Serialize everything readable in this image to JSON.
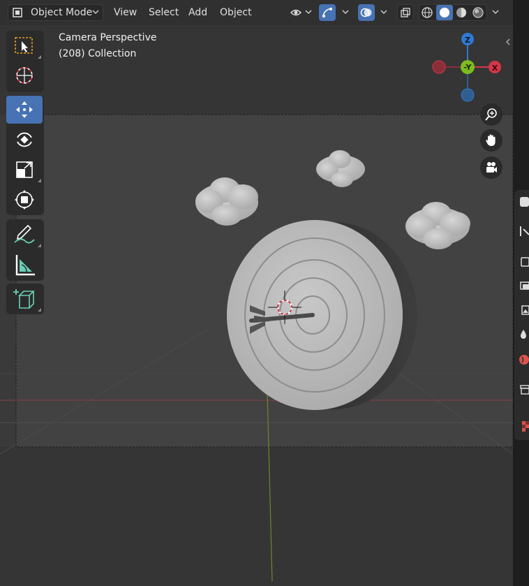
{
  "header": {
    "mode_label": "Object Mode",
    "menu": [
      "View",
      "Select",
      "Add",
      "Object"
    ]
  },
  "viewport": {
    "perspective_label": "Camera Perspective",
    "collection_label": "(208) Collection"
  },
  "gizmo": {
    "z_label": "Z",
    "y_label": "-Y",
    "x_label": "X"
  },
  "colors": {
    "active_tool": "#4772b3",
    "axis_x": "#d63648",
    "axis_y": "#7cbb1f",
    "axis_z": "#2f79cf",
    "header_bg": "#303030",
    "viewport_bg": "#3a3a3a"
  },
  "tools": [
    "select-box-icon",
    "cursor-icon",
    "move-icon",
    "rotate-icon",
    "scale-icon",
    "transform-icon",
    "annotate-icon",
    "measure-icon",
    "add-cube-icon"
  ]
}
